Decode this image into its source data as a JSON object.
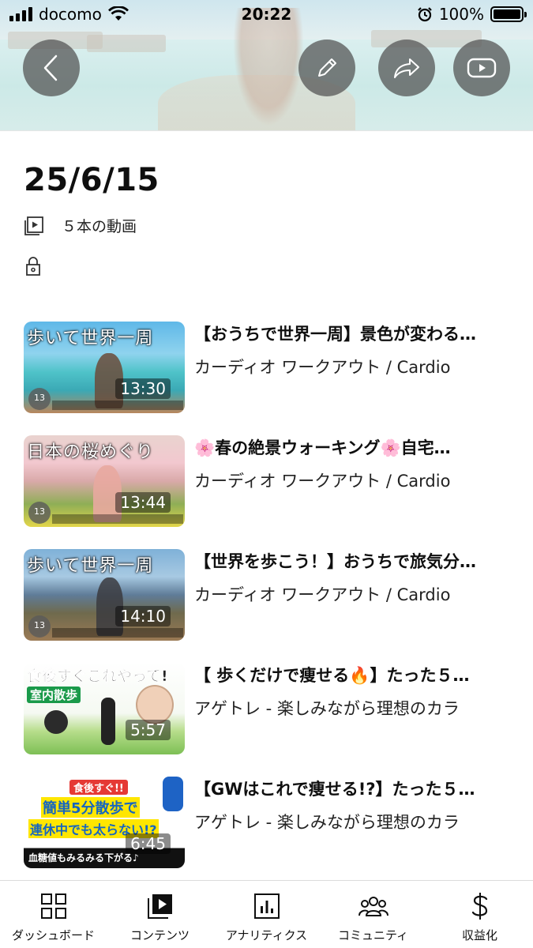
{
  "status_bar": {
    "carrier": "docomo",
    "time": "20:22",
    "battery": "100%"
  },
  "playlist": {
    "title": "25/6/15",
    "video_count": "５本の動画",
    "visibility_icon": "lock-icon"
  },
  "videos": [
    {
      "title": "【おうちで世界一周】景色が変わる…",
      "channel": "カーディオ ワークアウト / Cardio",
      "duration": "13:30",
      "thumb_text": "歩いて世界一周",
      "badge": "13"
    },
    {
      "title": "🌸春の絶景ウォーキング🌸自宅…",
      "channel": "カーディオ ワークアウト / Cardio",
      "duration": "13:44",
      "thumb_text": "日本の桜めぐり",
      "badge": "13"
    },
    {
      "title": "【世界を歩こう！】おうちで旅気分…",
      "channel": "カーディオ ワークアウト / Cardio",
      "duration": "14:10",
      "thumb_text": "歩いて世界一周",
      "badge": "13"
    },
    {
      "title": "【 歩くだけで痩せる🔥】たった５…",
      "channel": "アゲトレ - 楽しみながら理想のカラ",
      "duration": "5:57",
      "thumb_text": "食後すぐこれやって!",
      "thumb_subtext": "室内散歩"
    },
    {
      "title": "【GWはこれで痩せる!?】たった５…",
      "channel": "アゲトレ - 楽しみながら理想のカラ",
      "duration": "6:45",
      "thumb_text": "簡単5分散歩で",
      "thumb_subtext": "連休中でも太らない!?",
      "thumb_top": "食後すぐ!!",
      "thumb_bottom": "血糖値もみるみる下がる♪"
    }
  ],
  "bottom_nav": [
    {
      "label": "ダッシュボード",
      "icon": "dashboard-icon"
    },
    {
      "label": "コンテンツ",
      "icon": "content-icon"
    },
    {
      "label": "アナリティクス",
      "icon": "analytics-icon"
    },
    {
      "label": "コミュニティ",
      "icon": "community-icon"
    },
    {
      "label": "収益化",
      "icon": "monetization-icon"
    }
  ]
}
